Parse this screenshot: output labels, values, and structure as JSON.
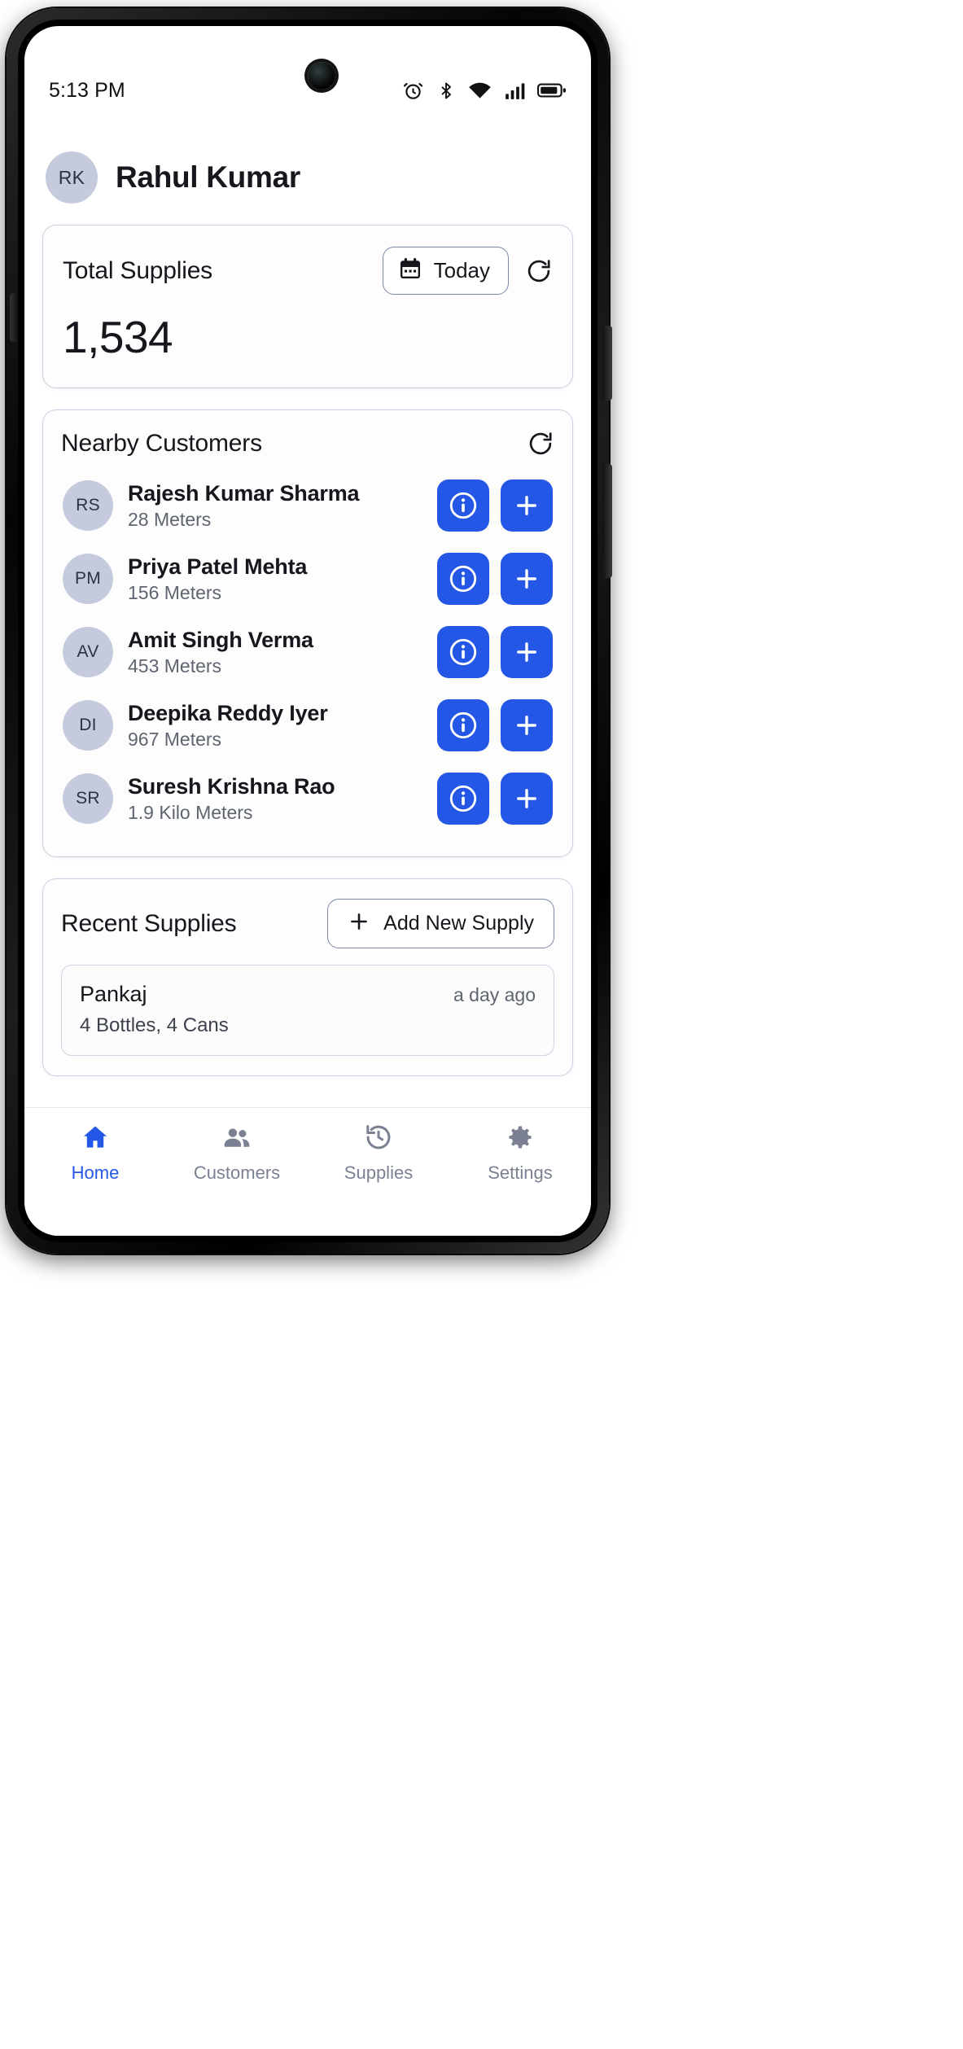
{
  "status_bar": {
    "time": "5:13 PM",
    "icons": [
      "alarm-icon",
      "bluetooth-icon",
      "wifi-icon",
      "cellular-signal-icon",
      "battery-icon"
    ]
  },
  "header": {
    "avatar_initials": "RK",
    "user_name": "Rahul Kumar"
  },
  "total_supplies": {
    "title": "Total Supplies",
    "today_label": "Today",
    "value": "1,534"
  },
  "nearby": {
    "title": "Nearby Customers",
    "customers": [
      {
        "initials": "RS",
        "name": "Rajesh Kumar Sharma",
        "distance": "28 Meters"
      },
      {
        "initials": "PM",
        "name": "Priya Patel Mehta",
        "distance": "156 Meters"
      },
      {
        "initials": "AV",
        "name": "Amit Singh Verma",
        "distance": "453 Meters"
      },
      {
        "initials": "DI",
        "name": "Deepika Reddy Iyer",
        "distance": "967 Meters"
      },
      {
        "initials": "SR",
        "name": "Suresh Krishna Rao",
        "distance": "1.9 Kilo Meters"
      }
    ]
  },
  "recent": {
    "title": "Recent Supplies",
    "add_label": "Add New Supply",
    "items": [
      {
        "name": "Pankaj",
        "time": "a day ago",
        "detail": "4 Bottles, 4 Cans"
      }
    ]
  },
  "bottom_nav": {
    "items": [
      {
        "label": "Home",
        "icon": "home-icon",
        "active": true
      },
      {
        "label": "Customers",
        "icon": "people-icon",
        "active": false
      },
      {
        "label": "Supplies",
        "icon": "history-icon",
        "active": false
      },
      {
        "label": "Settings",
        "icon": "gear-icon",
        "active": false
      }
    ]
  },
  "colors": {
    "accent": "#2457e6",
    "avatar_bg": "#c5cbdd",
    "card_border": "#c9d0e2",
    "muted_text": "#5e6470"
  }
}
